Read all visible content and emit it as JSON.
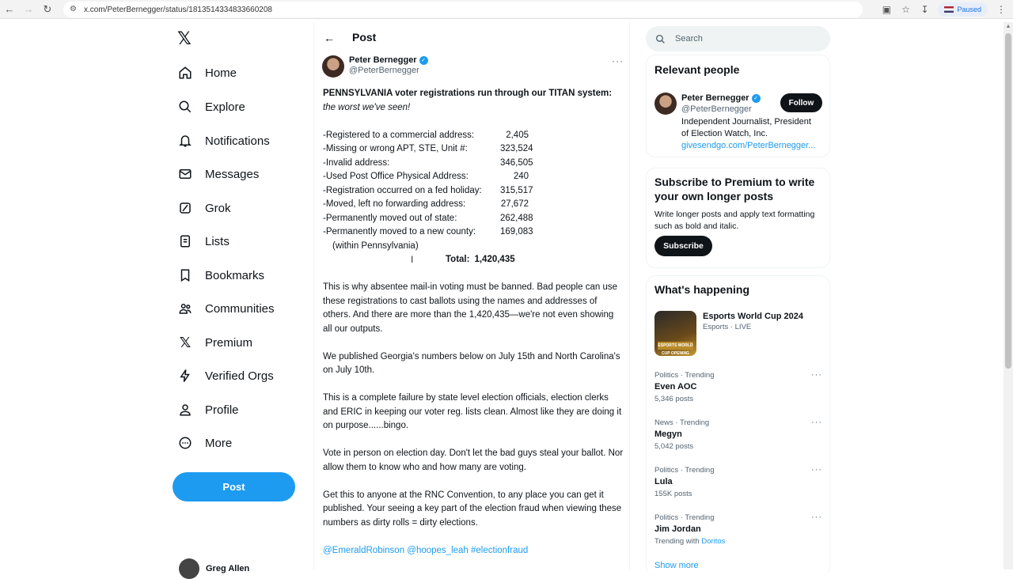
{
  "browser": {
    "url": "x.com/PeterBernegger/status/1813514334833660208",
    "paused_label": "Paused"
  },
  "nav": {
    "items": [
      {
        "label": "Home",
        "icon": "home-icon"
      },
      {
        "label": "Explore",
        "icon": "search-icon"
      },
      {
        "label": "Notifications",
        "icon": "bell-icon"
      },
      {
        "label": "Messages",
        "icon": "envelope-icon"
      },
      {
        "label": "Grok",
        "icon": "grok-icon"
      },
      {
        "label": "Lists",
        "icon": "list-icon"
      },
      {
        "label": "Bookmarks",
        "icon": "bookmark-icon"
      },
      {
        "label": "Communities",
        "icon": "communities-icon"
      },
      {
        "label": "Premium",
        "icon": "x-logo-icon"
      },
      {
        "label": "Verified Orgs",
        "icon": "lightning-icon"
      },
      {
        "label": "Profile",
        "icon": "person-icon"
      },
      {
        "label": "More",
        "icon": "more-circle-icon"
      }
    ],
    "post_button": "Post",
    "account_name": "Greg Allen"
  },
  "post": {
    "header_title": "Post",
    "author_name": "Peter Bernegger",
    "author_handle": "@PeterBernegger",
    "headline": "PENNSYLVANIA voter registrations run through our TITAN system:",
    "subhead": "the worst we've seen!",
    "stats": [
      {
        "label": "-Registered to a commercial address:",
        "value": "2,405"
      },
      {
        "label": "-Missing or wrong APT, STE, Unit #:",
        "value": "323,524"
      },
      {
        "label": "-Invalid address:",
        "value": "346,505"
      },
      {
        "label": "-Used Post Office Physical Address:",
        "value": "240"
      },
      {
        "label": "-Registration occurred on a fed holiday:",
        "value": "315,517"
      },
      {
        "label": "-Moved, left no forwarding address:",
        "value": "27,672"
      },
      {
        "label": "-Permanently moved out of state:",
        "value": "262,488"
      },
      {
        "label": "-Permanently moved to a new county:",
        "value": "169,083"
      }
    ],
    "stats_note": "(within Pennsylvania)",
    "total_label": "Total:",
    "total_value": "1,420,435",
    "paragraphs": [
      "This is why absentee mail-in voting must be banned. Bad people can use these registrations to cast ballots using the names and addresses of others. And there are more than the 1,420,435—we're not even showing all our outputs.",
      "We published Georgia's numbers below on July 15th and  North Carolina's on July 10th.",
      "This is a complete failure by state level election officials,  election clerks and ERIC in keeping our voter reg. lists clean. Almost like they are doing it on purpose......bingo.",
      "Vote in person on election day. Don't let the bad guys steal your ballot. Nor allow them to know who and how many are voting.",
      "Get this to anyone at the RNC Convention, to any place you can get it published. Your seeing a key part of the election fraud when viewing these numbers as dirty rolls = dirty elections."
    ],
    "mentions": "@EmeraldRobinson @hoopes_leah #electionfraud"
  },
  "sidebar": {
    "search_placeholder": "Search",
    "relevant_title": "Relevant people",
    "relevant_name": "Peter Bernegger",
    "relevant_handle": "@PeterBernegger",
    "relevant_bio": "Independent Journalist, President of Election Watch, Inc.",
    "relevant_link": "givesendgo.com/PeterBernegger...",
    "follow_label": "Follow",
    "premium_title": "Subscribe to Premium to write your own longer posts",
    "premium_text": "Write longer posts and apply text formatting such as bold and italic.",
    "subscribe_label": "Subscribe",
    "happening_title": "What's happening",
    "esports_title": "Esports World Cup 2024",
    "esports_sub": "Esports · LIVE",
    "esports_badge": "ESPORTS WORLD CUP OPENING SHOW",
    "trends": [
      {
        "category": "Politics · Trending",
        "name": "Even AOC",
        "count": "5,346 posts"
      },
      {
        "category": "News · Trending",
        "name": "Megyn",
        "count": "5,042 posts"
      },
      {
        "category": "Politics · Trending",
        "name": "Lula",
        "count": "155K posts"
      },
      {
        "category": "Politics · Trending",
        "name": "Jim Jordan",
        "count_prefix": "Trending with ",
        "count_link": "Doritos"
      }
    ],
    "show_more": "Show more"
  }
}
